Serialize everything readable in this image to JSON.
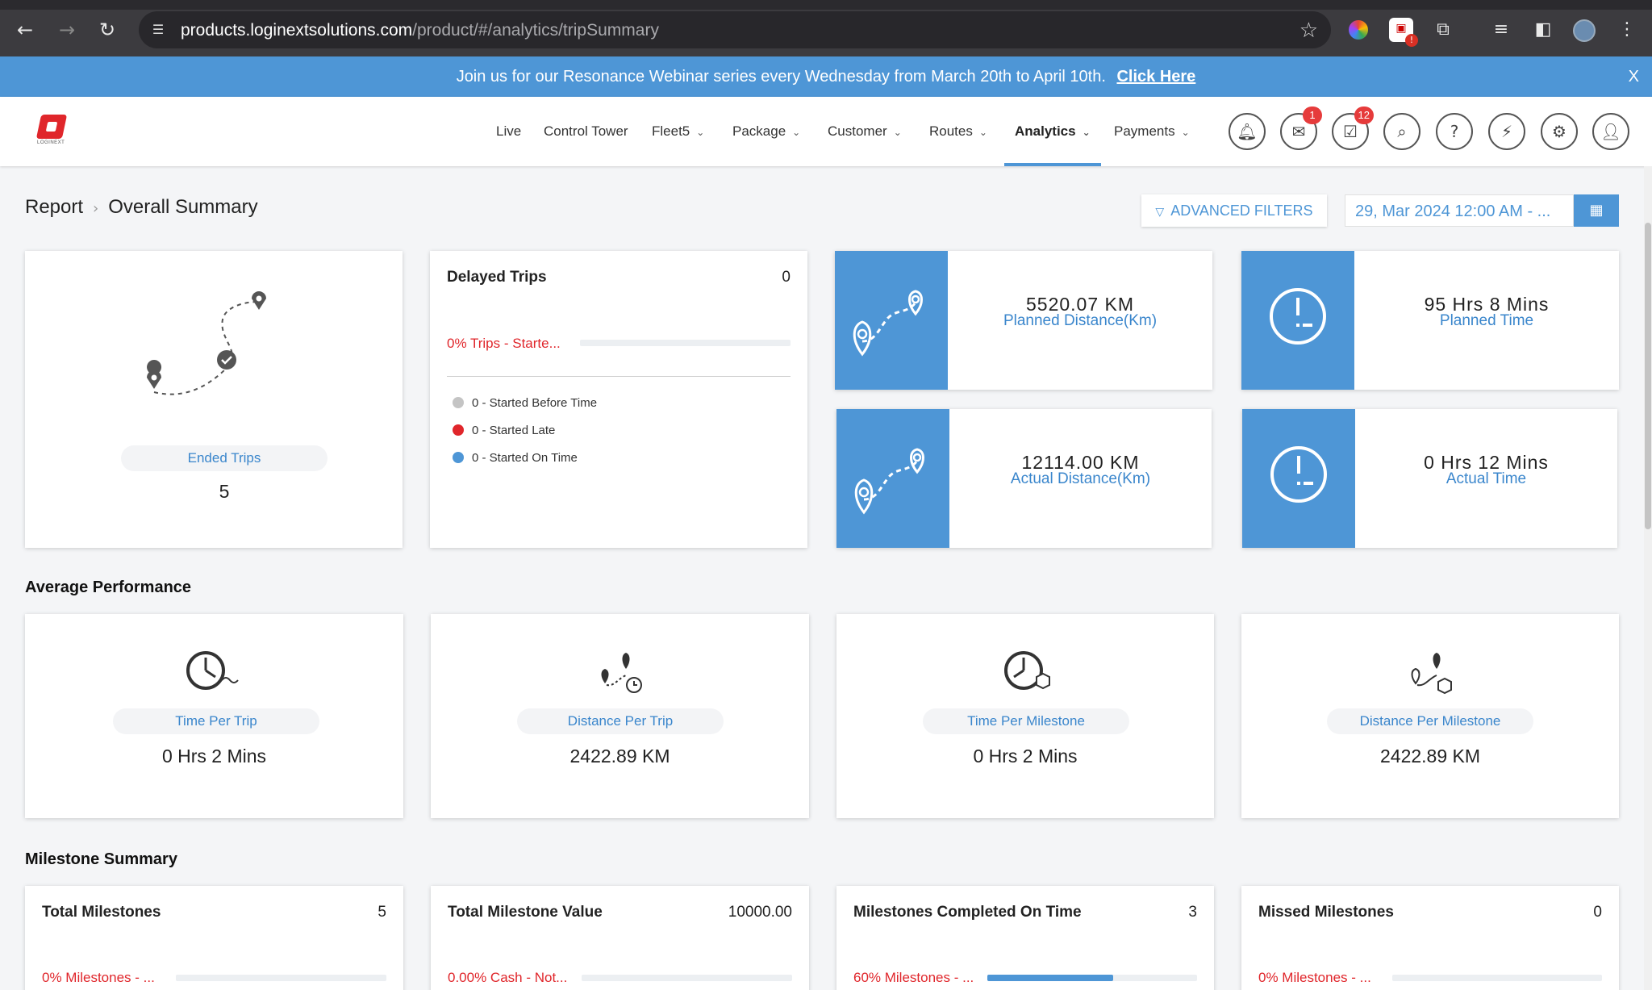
{
  "browser": {
    "url_host": "products.loginextsolutions.com",
    "url_path": "/product/#/analytics/tripSummary"
  },
  "banner": {
    "text": "Join us for our Resonance Webinar series every Wednesday from March 20th to April 10th.",
    "link": "Click Here",
    "close": "X"
  },
  "header": {
    "logo_text": "LOGINEXT",
    "nav": [
      {
        "label": "Live"
      },
      {
        "label": "Control Tower"
      },
      {
        "label": "Fleet5"
      },
      {
        "label": "Package"
      },
      {
        "label": "Customer"
      },
      {
        "label": "Routes"
      },
      {
        "label": "Analytics"
      },
      {
        "label": "Payments"
      }
    ],
    "badges": {
      "messages": "1",
      "tasks": "12"
    }
  },
  "page": {
    "breadcrumb": {
      "parent": "Report",
      "current": "Overall Summary"
    },
    "advanced_filters": "ADVANCED FILTERS",
    "date_range": "29, Mar 2024 12:00 AM - ..."
  },
  "trips": {
    "ended_label": "Ended Trips",
    "ended_value": "5"
  },
  "delayed": {
    "title": "Delayed Trips",
    "count": "0",
    "status": "0% Trips - Starte...",
    "progress": 0,
    "legend": [
      {
        "label": "0 - Started Before Time",
        "color": "#c4c4c4"
      },
      {
        "label": "0 - Started Late",
        "color": "#e0262b"
      },
      {
        "label": "0 - Started On Time",
        "color": "#4e96d6"
      }
    ]
  },
  "stats": {
    "planned_distance": {
      "value": "5520.07 KM",
      "label": "Planned Distance(Km)"
    },
    "actual_distance": {
      "value": "12114.00 KM",
      "label": "Actual Distance(Km)"
    },
    "planned_time": {
      "value": "95 Hrs 8 Mins",
      "label": "Planned Time"
    },
    "actual_time": {
      "value": "0 Hrs 12 Mins",
      "label": "Actual Time"
    }
  },
  "average_performance": {
    "title": "Average Performance",
    "cards": [
      {
        "label": "Time Per Trip",
        "value": "0 Hrs 2 Mins"
      },
      {
        "label": "Distance Per Trip",
        "value": "2422.89 KM"
      },
      {
        "label": "Time Per Milestone",
        "value": "0 Hrs 2 Mins"
      },
      {
        "label": "Distance Per Milestone",
        "value": "2422.89 KM"
      }
    ]
  },
  "milestone_summary": {
    "title": "Milestone Summary",
    "cards": [
      {
        "title": "Total Milestones",
        "count": "5",
        "status": "0% Milestones - ...",
        "progress": 0
      },
      {
        "title": "Total Milestone Value",
        "count": "10000.00",
        "status": "0.00% Cash - Not...",
        "progress": 0
      },
      {
        "title": "Milestones Completed On Time",
        "count": "3",
        "status": "60% Milestones - ...",
        "progress": 0.6
      },
      {
        "title": "Missed Milestones",
        "count": "0",
        "status": "0% Milestones - ...",
        "progress": 0
      }
    ]
  },
  "colors": {
    "accent": "#4e96d6",
    "alert": "#e0262b"
  }
}
